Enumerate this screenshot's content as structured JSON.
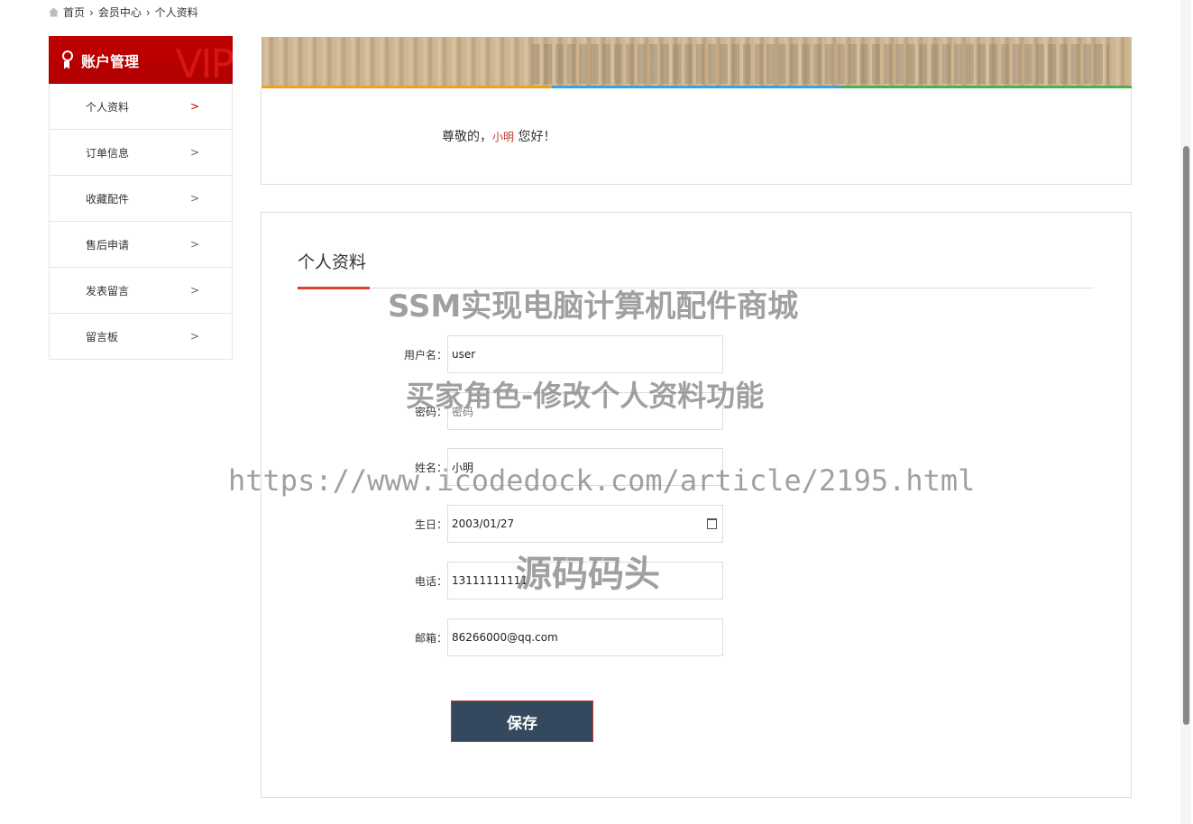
{
  "breadcrumb": [
    "首页",
    "会员中心",
    "个人资料"
  ],
  "sidebar": {
    "title": "账户管理",
    "badge": "VIP",
    "items": [
      {
        "label": "个人资料",
        "active": true
      },
      {
        "label": "订单信息"
      },
      {
        "label": "收藏配件"
      },
      {
        "label": "售后申请"
      },
      {
        "label": "发表留言"
      },
      {
        "label": "留言板"
      }
    ]
  },
  "greeting": {
    "prefix": "尊敬的，",
    "name": "小明",
    "suffix": " 您好！"
  },
  "stripe_colors": [
    "#f0a020",
    "#3aa0e0",
    "#4caf50"
  ],
  "form": {
    "title": "个人资料",
    "fields": [
      {
        "label": "用户名：",
        "value": "user"
      },
      {
        "label": "密码：",
        "value": "",
        "placeholder": "密码"
      },
      {
        "label": "姓名：",
        "value": "小明"
      },
      {
        "label": "生日：",
        "value": "2003/01/27"
      },
      {
        "label": "电话：",
        "value": "13111111111"
      },
      {
        "label": "邮箱：",
        "value": "86266000@qq.com"
      }
    ],
    "save_label": "保存"
  },
  "watermark": [
    "SSM实现电脑计算机配件商城",
    "买家角色-修改个人资料功能",
    "https://www.icodedock.com/article/2195.html",
    "源码码头"
  ]
}
